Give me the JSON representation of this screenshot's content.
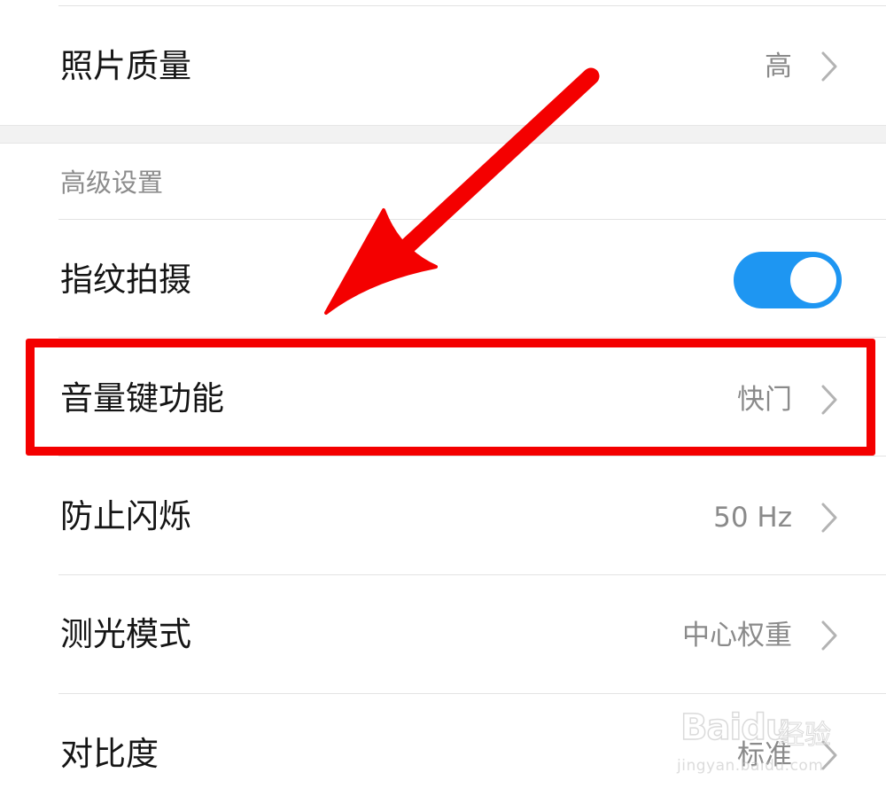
{
  "settings": {
    "photo_quality": {
      "label": "照片质量",
      "value": "高"
    },
    "advanced_header": "高级设置",
    "fingerprint_capture": {
      "label": "指纹拍摄",
      "enabled": true
    },
    "volume_key_function": {
      "label": "音量键功能",
      "value": "快门"
    },
    "anti_flicker": {
      "label": "防止闪烁",
      "value": "50 Hz"
    },
    "metering_mode": {
      "label": "测光模式",
      "value": "中心权重"
    },
    "contrast": {
      "label": "对比度",
      "value": "标准"
    }
  },
  "annotation": {
    "color": "#f40000",
    "type": "red-arrow-and-box"
  },
  "watermark": {
    "logo": "Baidu",
    "text": "经验",
    "url": "jingyan.baidu.com"
  },
  "colors": {
    "toggle_on": "#1e96f2",
    "value_text": "#8a8a8a",
    "section_header": "#8c8c8c"
  }
}
